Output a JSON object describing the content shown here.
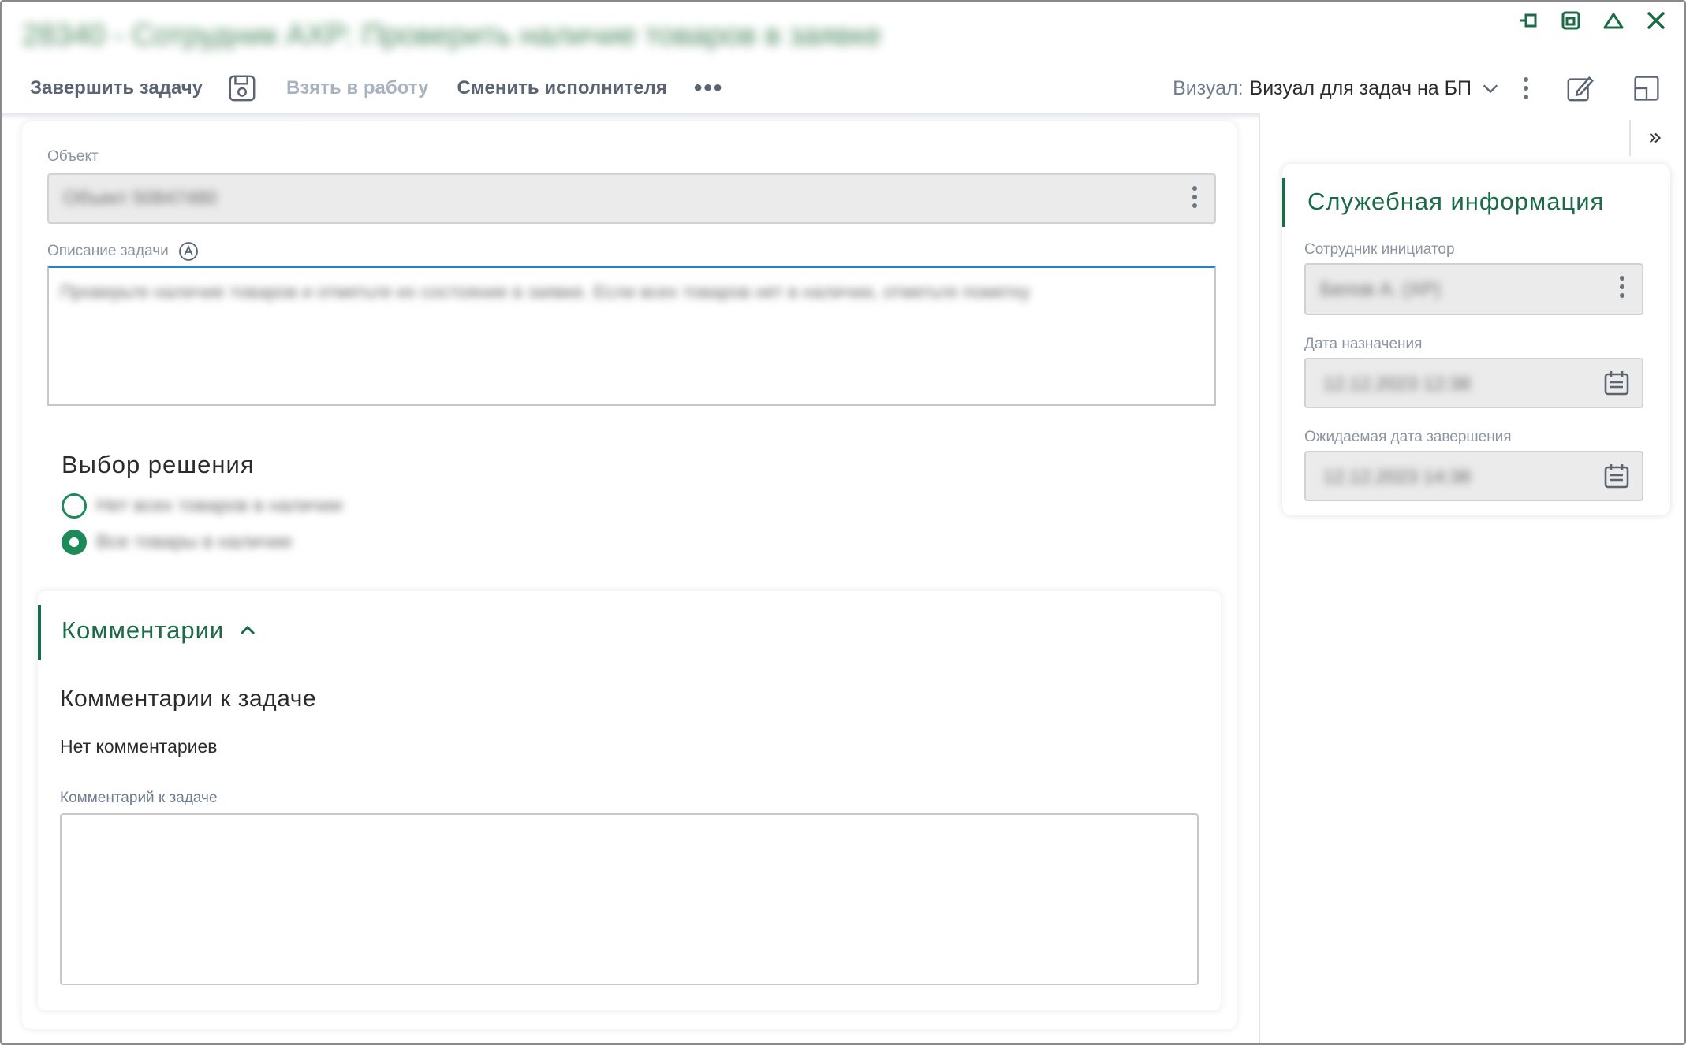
{
  "window": {
    "title": "28340 - Сотрудник АХР: Проверить наличие товаров в заявке"
  },
  "toolbar": {
    "complete_task": "Завершить задачу",
    "take_to_work": "Взять в работу",
    "change_assignee": "Сменить исполнителя",
    "more": "•••",
    "visual_label": "Визуал:",
    "visual_value": "Визуал для задач на БП"
  },
  "form": {
    "object_label": "Объект",
    "object_value": "Объект 50847480",
    "description_label": "Описание задачи",
    "description_value": "Проверьте наличие товаров и отметьте их состояние в заявке. Если всех товаров нет в наличии, отметьте пометку",
    "decision_title": "Выбор решения",
    "decision_options": [
      {
        "label": "Нет всех товаров в наличии",
        "selected": false
      },
      {
        "label": "Все товары в наличии",
        "selected": true
      }
    ]
  },
  "comments": {
    "header": "Комментарии",
    "subtitle": "Комментарии к задаче",
    "empty_text": "Нет комментариев",
    "input_label": "Комментарий к задаче",
    "input_value": ""
  },
  "service_info": {
    "title": "Служебная информация",
    "initiator_label": "Сотрудник инициатор",
    "initiator_value": "Белов А. (ХР)",
    "assigned_date_label": "Дата назначения",
    "assigned_date_value": "12.12.2023 12:38",
    "expected_date_label": "Ожидаемая дата завершения",
    "expected_date_value": "12.12.2023 14:38"
  },
  "colors": {
    "accent_green": "#1b6b49",
    "radio_green": "#1e8a5a",
    "focus_blue": "#2f7ec0"
  },
  "icons": {
    "save": "save-icon",
    "window_controls": [
      "pin-icon",
      "restore-icon",
      "minimize-icon",
      "close-icon"
    ],
    "edit": "edit-icon",
    "layout": "layout-icon",
    "calendar": "calendar-icon"
  }
}
